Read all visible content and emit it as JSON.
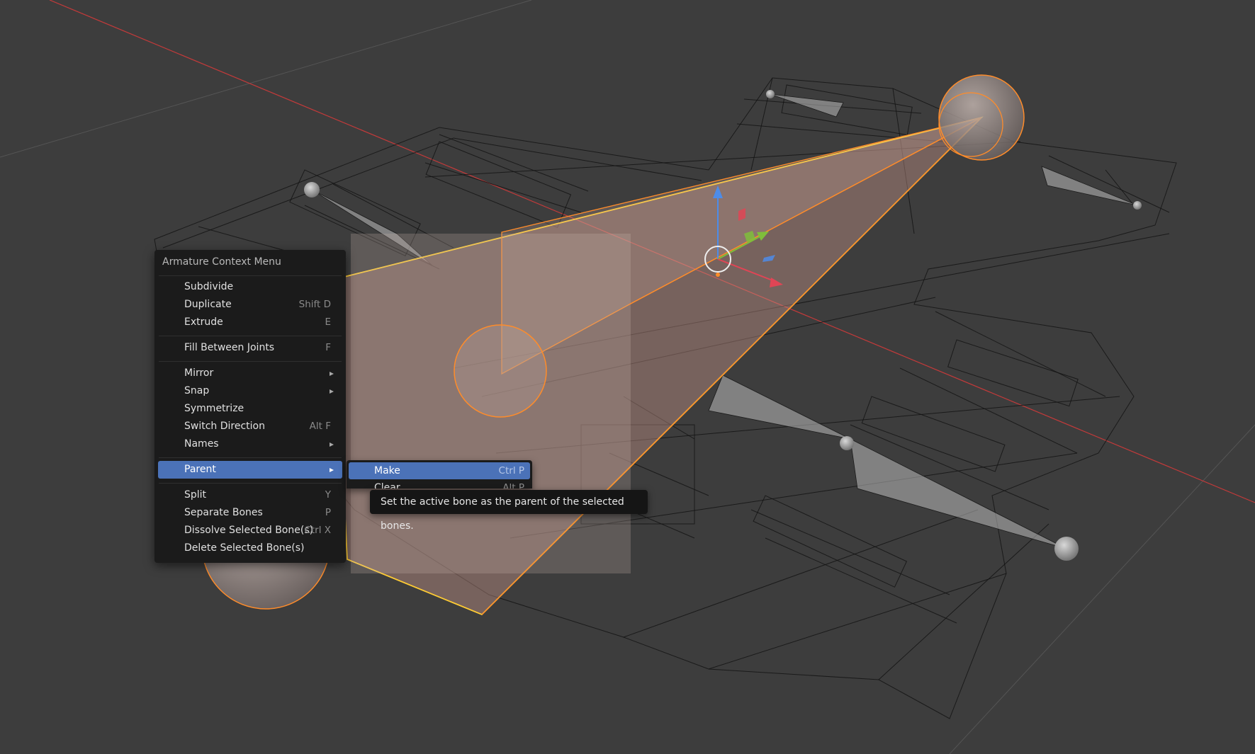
{
  "app": {
    "editor": "3D Viewport",
    "mode": "Armature Edit"
  },
  "colors": {
    "viewport_bg": "#3d3d3d",
    "menu_bg": "#1b1b1b",
    "highlight": "#4b72b8",
    "selected_bone": "#ff8c2a",
    "active_bone_outline": "#ffcc33",
    "x_axis": "#c33a3a",
    "gizmo_x": "#e04555",
    "gizmo_y": "#7fbe3b",
    "gizmo_z": "#4d8ce8"
  },
  "context_menu": {
    "title": "Armature Context Menu",
    "items": [
      {
        "label": "Subdivide",
        "shortcut": ""
      },
      {
        "label": "Duplicate",
        "shortcut": "Shift D"
      },
      {
        "label": "Extrude",
        "shortcut": "E"
      },
      {
        "label": "Fill Between Joints",
        "shortcut": "F"
      },
      {
        "label": "Mirror",
        "shortcut": "",
        "submenu": true
      },
      {
        "label": "Snap",
        "shortcut": "",
        "submenu": true
      },
      {
        "label": "Symmetrize",
        "shortcut": ""
      },
      {
        "label": "Switch Direction",
        "shortcut": "Alt F"
      },
      {
        "label": "Names",
        "shortcut": "",
        "submenu": true
      },
      {
        "label": "Parent",
        "shortcut": "",
        "submenu": true,
        "active": true
      },
      {
        "label": "Split",
        "shortcut": "Y"
      },
      {
        "label": "Separate Bones",
        "shortcut": "P"
      },
      {
        "label": "Dissolve Selected Bone(s)",
        "shortcut": "Ctrl X"
      },
      {
        "label": "Delete Selected Bone(s)",
        "shortcut": ""
      }
    ]
  },
  "parent_submenu": {
    "items": [
      {
        "label": "Make",
        "shortcut": "Ctrl P",
        "active": true
      },
      {
        "label": "Clear",
        "shortcut": "Alt P"
      }
    ]
  },
  "tooltip": {
    "text": "Set the active bone as the parent of the selected bones."
  }
}
